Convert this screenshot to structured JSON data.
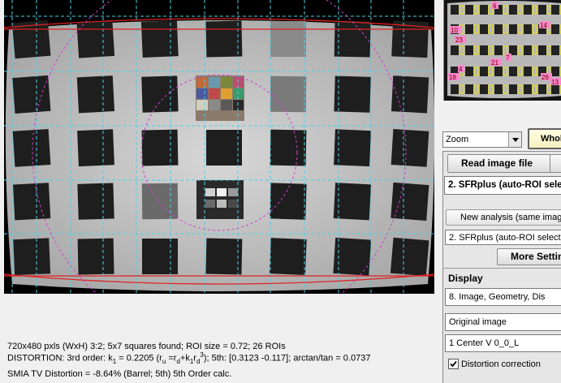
{
  "panel": {
    "zoom_select": "Zoom",
    "whole_button": "Whol",
    "read_image_button": "Read image file",
    "analysis_select": "2. SFRplus (auto-ROI sele",
    "new_analysis_button": "New analysis (same imag",
    "analysis_select_2": "2. SFRplus (auto-ROI select)",
    "more_settings_button": "More Settin",
    "display_header": "Display",
    "display_select": "8.  Image, Geometry, Dis",
    "image_select": "Original image",
    "center_select": "1  Center  V     0_0_L",
    "distortion_checkbox_label": "Distortion correction",
    "distortion_checked": true
  },
  "info": {
    "line1": "720x480 pxls (WxH) 3:2;   5x7 squares found;   ROI size = 0.72;   26 ROIs",
    "line2_pre": "DISTORTION:  3rd order:  k",
    "line2_k_sub": "1",
    "line2_k_val": " = 0.2205  (r",
    "line2_ru_sub": "u",
    "line2_eq": " =r",
    "line2_rd_sub": "d",
    "line2_plus": "+k",
    "line2_k1_sub": "1",
    "line2_rd2": "r",
    "line2_rd2_sub": "d",
    "line2_cube": "3",
    "line2_post": ");   5th: [0.3123  -0.117];   arctan/tan = 0.0737",
    "line3": "SMIA TV Distortion = -8.64%  (Barrel; 5th)   5th Order calc."
  },
  "thumbnail_labels": [
    "6",
    "10",
    "14",
    "23",
    "7",
    "21",
    "4",
    "18",
    "26",
    "13"
  ],
  "colors": {
    "grid_line": "#4fd0e8",
    "distortion_curve": "#e02020",
    "circle": "#d040d0",
    "roi_box": "#e8e000",
    "thumb_label_bg": "#ff88cc"
  }
}
